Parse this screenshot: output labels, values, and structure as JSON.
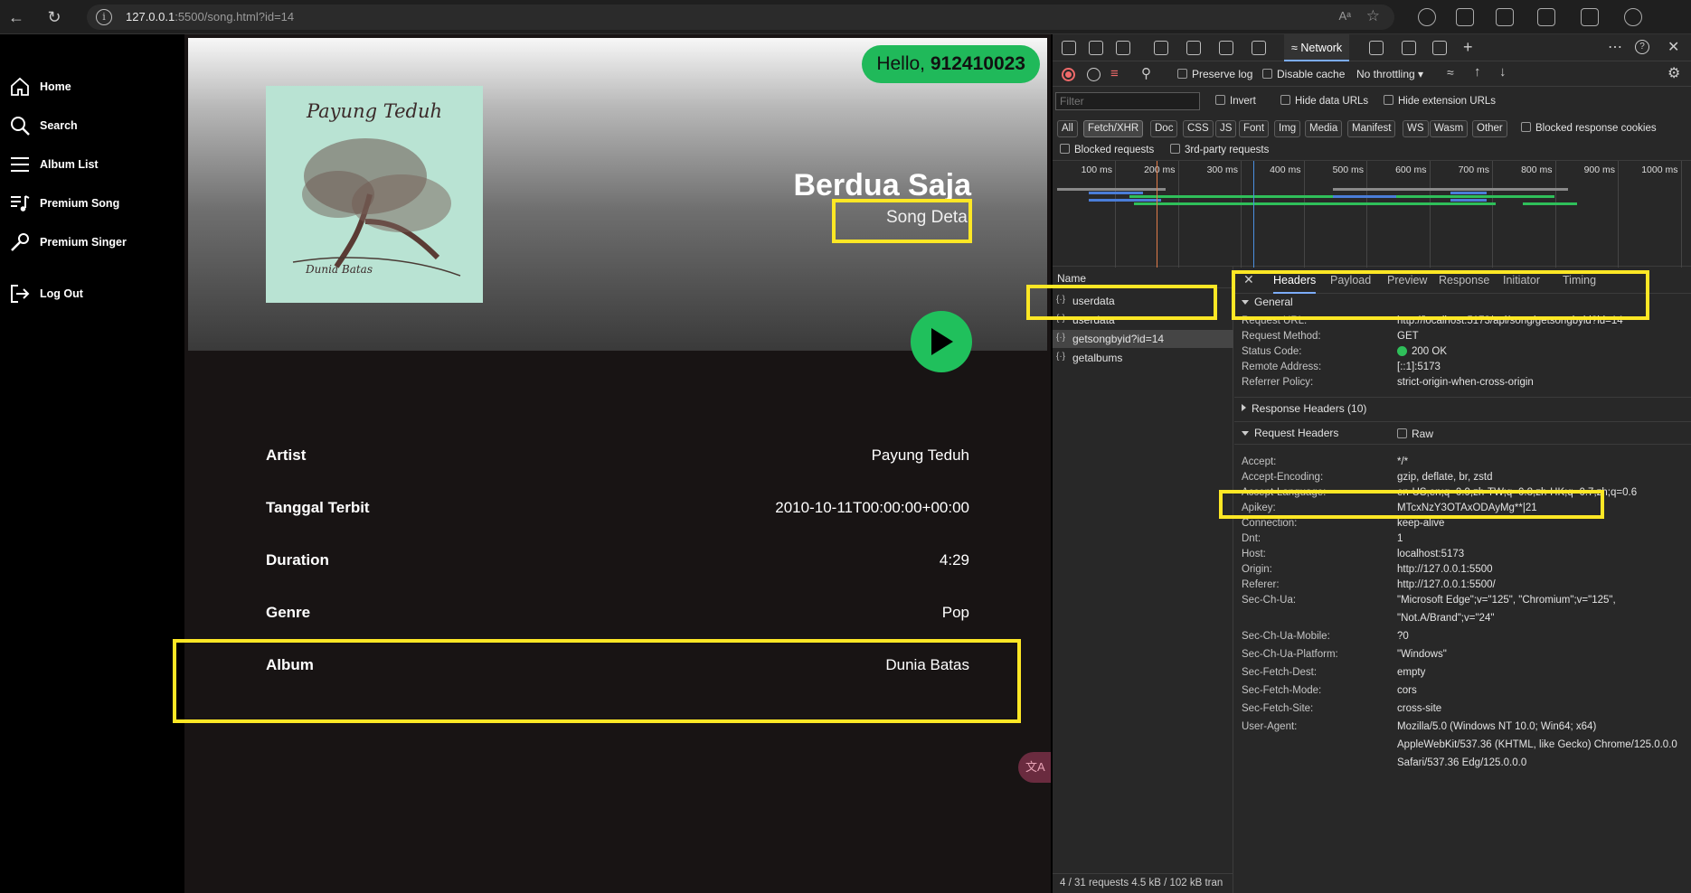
{
  "browser": {
    "url_host": "127.0.0.1",
    "url_rest": ":5500/song.html?id=14"
  },
  "sidebar": {
    "items": [
      {
        "label": "Home",
        "icon": "home-icon"
      },
      {
        "label": "Search",
        "icon": "search-icon"
      },
      {
        "label": "Album List",
        "icon": "list-icon"
      },
      {
        "label": "Premium Song",
        "icon": "music-list-icon"
      },
      {
        "label": "Premium Singer",
        "icon": "microphone-icon"
      },
      {
        "label": "Log Out",
        "icon": "logout-icon"
      }
    ]
  },
  "song": {
    "greeting": "Hello,",
    "user_id": "912410023",
    "cover_title": "Payung Teduh",
    "cover_subtitle": "Dunia Batas",
    "title": "Berdua Saja",
    "subtitle": "Song Detai",
    "details": [
      {
        "label": "Artist",
        "value": "Payung Teduh"
      },
      {
        "label": "Tanggal Terbit",
        "value": "2010-10-11T00:00:00+00:00"
      },
      {
        "label": "Duration",
        "value": "4:29"
      },
      {
        "label": "Genre",
        "value": "Pop"
      },
      {
        "label": "Album",
        "value": "Dunia Batas"
      }
    ],
    "translate_badge": "文A"
  },
  "devtools": {
    "active_tool": "Network",
    "toolbar": {
      "preserve_log": "Preserve log",
      "disable_cache": "Disable cache",
      "throttling": "No throttling"
    },
    "filter_placeholder": "Filter",
    "filter_options": {
      "invert": "Invert",
      "hide_data": "Hide data URLs",
      "hide_ext": "Hide extension URLs",
      "blocked_cookies": "Blocked response cookies",
      "blocked_requests": "Blocked requests",
      "third_party": "3rd-party requests"
    },
    "type_filters": [
      "All",
      "Fetch/XHR",
      "Doc",
      "CSS",
      "JS",
      "Font",
      "Img",
      "Media",
      "Manifest",
      "WS",
      "Wasm",
      "Other"
    ],
    "active_filter": "Fetch/XHR",
    "timeline_ticks": [
      "100 ms",
      "200 ms",
      "300 ms",
      "400 ms",
      "500 ms",
      "600 ms",
      "700 ms",
      "800 ms",
      "900 ms",
      "1000 ms"
    ],
    "name_header": "Name",
    "requests": [
      "userdata",
      "userdata",
      "getsongbyid?id=14",
      "getalbums"
    ],
    "selected_request": "getsongbyid?id=14",
    "status_bar": "4 / 31 requests  4.5 kB / 102 kB tran",
    "detail_tabs": [
      "Headers",
      "Payload",
      "Preview",
      "Response",
      "Initiator",
      "Timing"
    ],
    "active_detail_tab": "Headers",
    "general_label": "General",
    "general": [
      {
        "k": "Request URL:",
        "v": "http://localhost:5173/api/song/getsongbyid?id=14"
      },
      {
        "k": "Request Method:",
        "v": "GET"
      },
      {
        "k": "Status Code:",
        "v": "200 OK"
      },
      {
        "k": "Remote Address:",
        "v": "[::1]:5173"
      },
      {
        "k": "Referrer Policy:",
        "v": "strict-origin-when-cross-origin"
      }
    ],
    "response_headers_label": "Response Headers (10)",
    "request_headers_label": "Request Headers",
    "raw_label": "Raw",
    "request_headers": [
      {
        "k": "Accept:",
        "v": "*/*"
      },
      {
        "k": "Accept-Encoding:",
        "v": "gzip, deflate, br, zstd"
      },
      {
        "k": "Accept-Language:",
        "v": "en-US,en;q=0.9,zh-TW;q=0.8,zh-HK;q=0.7,zh;q=0.6"
      },
      {
        "k": "Apikey:",
        "v": "MTcxNzY3OTAxODAyMg**|21"
      },
      {
        "k": "Connection:",
        "v": "keep-alive"
      },
      {
        "k": "Dnt:",
        "v": "1"
      },
      {
        "k": "Host:",
        "v": "localhost:5173"
      },
      {
        "k": "Origin:",
        "v": "http://127.0.0.1:5500"
      },
      {
        "k": "Referer:",
        "v": "http://127.0.0.1:5500/"
      },
      {
        "k": "Sec-Ch-Ua:",
        "v": "\"Microsoft Edge\";v=\"125\", \"Chromium\";v=\"125\", \"Not.A/Brand\";v=\"24\""
      },
      {
        "k": "Sec-Ch-Ua-Mobile:",
        "v": "?0"
      },
      {
        "k": "Sec-Ch-Ua-Platform:",
        "v": "\"Windows\""
      },
      {
        "k": "Sec-Fetch-Dest:",
        "v": "empty"
      },
      {
        "k": "Sec-Fetch-Mode:",
        "v": "cors"
      },
      {
        "k": "Sec-Fetch-Site:",
        "v": "cross-site"
      },
      {
        "k": "User-Agent:",
        "v": "Mozilla/5.0 (Windows NT 10.0; Win64; x64) AppleWebKit/537.36 (KHTML, like Gecko) Chrome/125.0.0.0 Safari/537.36 Edg/125.0.0.0"
      }
    ],
    "status_ok_color": "#2fbf5a"
  },
  "colors": {
    "highlight": "#fde725",
    "accent_green": "#20b95a",
    "devtools_tab_underline": "#7cacf8"
  }
}
